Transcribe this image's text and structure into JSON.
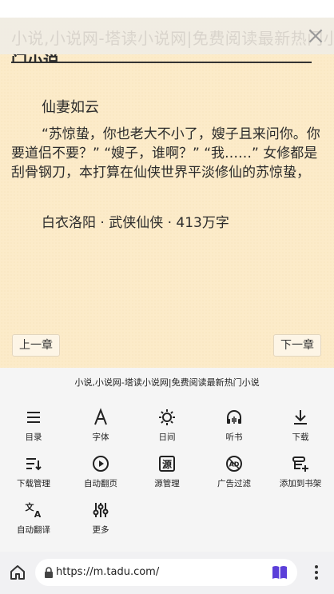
{
  "reader": {
    "site_title": "小说,小说网-塔读小说网|免费阅读最新热门小说",
    "chapter_title_partial": "门小说",
    "book_title": "仙妻如云",
    "book_desc": "“苏惊蛰，你也老大不小了，嫂子且来问你。你要道侣不要？” “嫂子，谁啊？” “我……” 女修都是刮骨钢刀，本打算在仙侠世界平淡修仙的苏惊蛰，",
    "book_meta": "白衣洛阳 · 武侠仙侠 · 413万字",
    "prev_chapter": "上一章",
    "next_chapter": "下一章"
  },
  "menu": {
    "title": "小说,小说网-塔读小说网|免费阅读最新热门小说",
    "items": [
      {
        "label": "目录",
        "icon": "list-icon"
      },
      {
        "label": "字体",
        "icon": "font-icon"
      },
      {
        "label": "日间",
        "icon": "sun-icon"
      },
      {
        "label": "听书",
        "icon": "headphones-icon"
      },
      {
        "label": "下载",
        "icon": "download-icon"
      },
      {
        "label": "下载管理",
        "icon": "download-list-icon"
      },
      {
        "label": "自动翻页",
        "icon": "play-circle-icon"
      },
      {
        "label": "源管理",
        "icon": "source-icon"
      },
      {
        "label": "广告过滤",
        "icon": "ad-block-icon"
      },
      {
        "label": "添加到书架",
        "icon": "add-bookshelf-icon"
      },
      {
        "label": "自动翻译",
        "icon": "translate-icon"
      },
      {
        "label": "更多",
        "icon": "sliders-icon"
      }
    ]
  },
  "browser": {
    "url": "https://m.tadu.com/"
  },
  "colors": {
    "reader_bg": "#fcebc9",
    "menu_bg": "#f5f5f5",
    "accent": "#5b3fd9"
  }
}
